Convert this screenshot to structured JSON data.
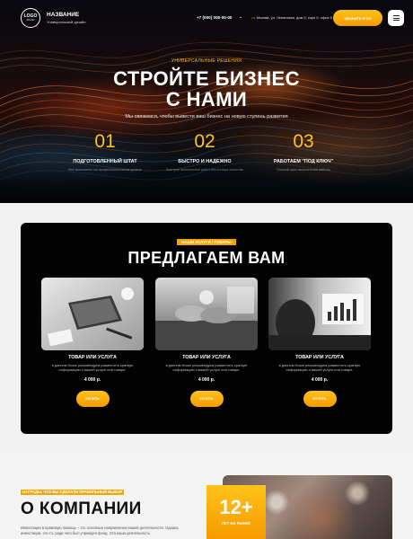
{
  "header": {
    "logo_main": "LOGO",
    "logo_sub": "BRAND",
    "brand_name": "НАЗВАНИЕ",
    "brand_subtitle": "Универсальный дизайн",
    "phone": "+7 (000) 000-00-00",
    "address": "г. Москва, ул. Ленинская, дом 0, корп 0, офис 0",
    "callback_button": "ЗВОНИТЕ Я ОН"
  },
  "hero": {
    "eyebrow": "УНИВЕРСАЛЬНЫЕ РЕШЕНИЯ",
    "title_line1": "СТРОЙТЕ БИЗНЕС",
    "title_line2": "С НАМИ",
    "subtitle": "Мы свяжемся, чтобы вывести ваш бизнес на новую ступень развития",
    "features": [
      {
        "num": "01",
        "title": "ПОДГОТОВЛЕННЫЙ ШТАТ",
        "desc": "Все выполнено на профессиональном уровне"
      },
      {
        "num": "02",
        "title": "БЫСТРО И НАДЕЖНО",
        "desc": "Быстрое выполнение работ без потери качества"
      },
      {
        "num": "03",
        "title": "РАБОТАЕМ \"ПОД КЛЮЧ\"",
        "desc": "Полный цикл выполнения работы"
      }
    ]
  },
  "services": {
    "tag": "НАШИ УСЛУГИ / ТОВАРЫ",
    "title": "ПРЕДЛАГАЕМ ВАМ",
    "cards": [
      {
        "title": "ТОВАР ИЛИ УСЛУГА",
        "desc": "в данном блоке рекомендуем разместить краткую информацию о вашей услуге или товаре.",
        "price": "4 000 р.",
        "button": "КУПИТЬ"
      },
      {
        "title": "ТОВАР ИЛИ УСЛУГА",
        "desc": "в данном блоке рекомендуем разместить краткую информацию о вашей услуге или товаре.",
        "price": "4 000 р.",
        "button": "КУПИТЬ"
      },
      {
        "title": "ТОВАР ИЛИ УСЛУГА",
        "desc": "в данном блоке рекомендуем разместить краткую информацию о вашей услуге или товаре.",
        "price": "4 000 р.",
        "button": "КУПИТЬ"
      }
    ]
  },
  "about": {
    "tag": "НАГРАДЫ, ЧТО ВЫ СДЕЛАЛИ ПРАВИЛЬНЫЙ ВЫБОР",
    "title": "О КОМПАНИИ",
    "text": "Инвестиции в правовую помощь – это основные направления нашей деятельности. Однако, инвестиции, это-то, ради чего был учрежден фонд. Эта наша деятельность",
    "stat_number": "12+",
    "stat_label": "ЛЕТ НА РЫНКЕ"
  },
  "colors": {
    "accent": "#f59a00",
    "accent_light": "#ffc21a",
    "dark_panel": "#020202"
  }
}
